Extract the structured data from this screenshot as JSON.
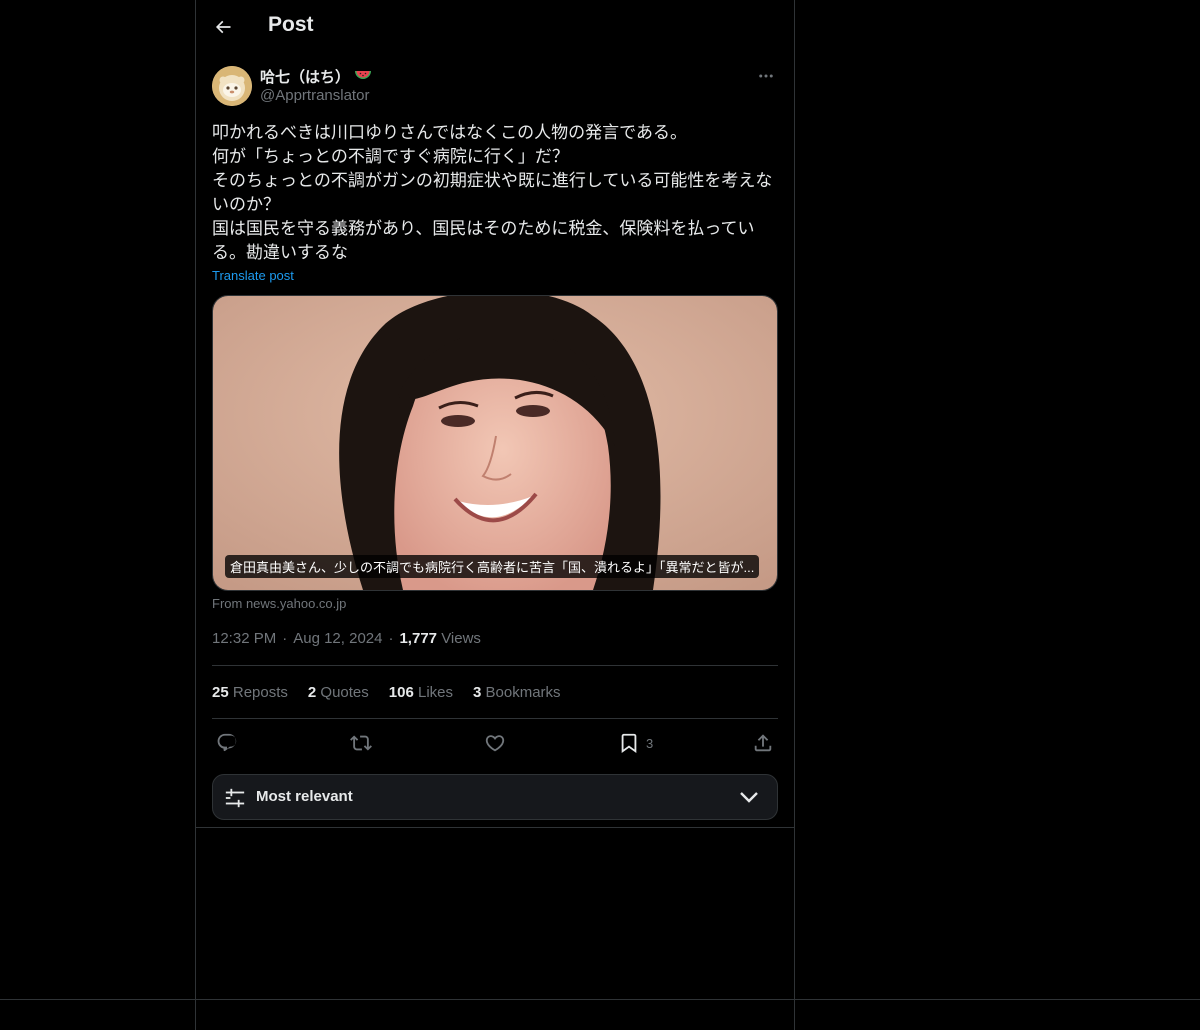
{
  "header": {
    "title": "Post",
    "back_icon": "arrow-left-icon"
  },
  "author": {
    "name": "哈七（はち）",
    "emoji": "watermelon",
    "handle": "@Apprtranslator"
  },
  "post": {
    "lines": [
      "叩かれるべきは川口ゆりさんではなくこの人物の発言である。",
      "何が「ちょっとの不調ですぐ病院に行く」だ？",
      "そのちょっとの不調がガンの初期症状や既に進行している可能性を考えな",
      "いのか？",
      "国は国民を守る義務があり、国民はそのために税金、保険料を払ってい",
      "る。勘違いするな"
    ],
    "translate_label": "Translate post"
  },
  "media": {
    "caption": "倉田真由美さん、少しの不調でも病院行く高齢者に苦言「国、潰れるよ」「異常だと皆が...",
    "source": "From news.yahoo.co.jp"
  },
  "meta": {
    "time": "12:32 PM",
    "date": "Aug 12, 2024",
    "views_count": "1,777",
    "views_label": "Views"
  },
  "stats": {
    "reposts_count": "25",
    "reposts_label": "Reposts",
    "quotes_count": "2",
    "quotes_label": "Quotes",
    "likes_count": "106",
    "likes_label": "Likes",
    "bookmarks_count": "3",
    "bookmarks_label": "Bookmarks"
  },
  "actions": {
    "reply_icon": "reply-icon",
    "repost_icon": "repost-icon",
    "like_icon": "heart-icon",
    "bookmark_icon": "bookmark-icon",
    "bookmark_count": "3",
    "share_icon": "share-icon"
  },
  "sort": {
    "label": "Most relevant"
  },
  "colors": {
    "background": "#000000",
    "text": "#e7e9ea",
    "secondary": "#71767b",
    "border": "#2f3336",
    "link": "#1d9bf0"
  }
}
